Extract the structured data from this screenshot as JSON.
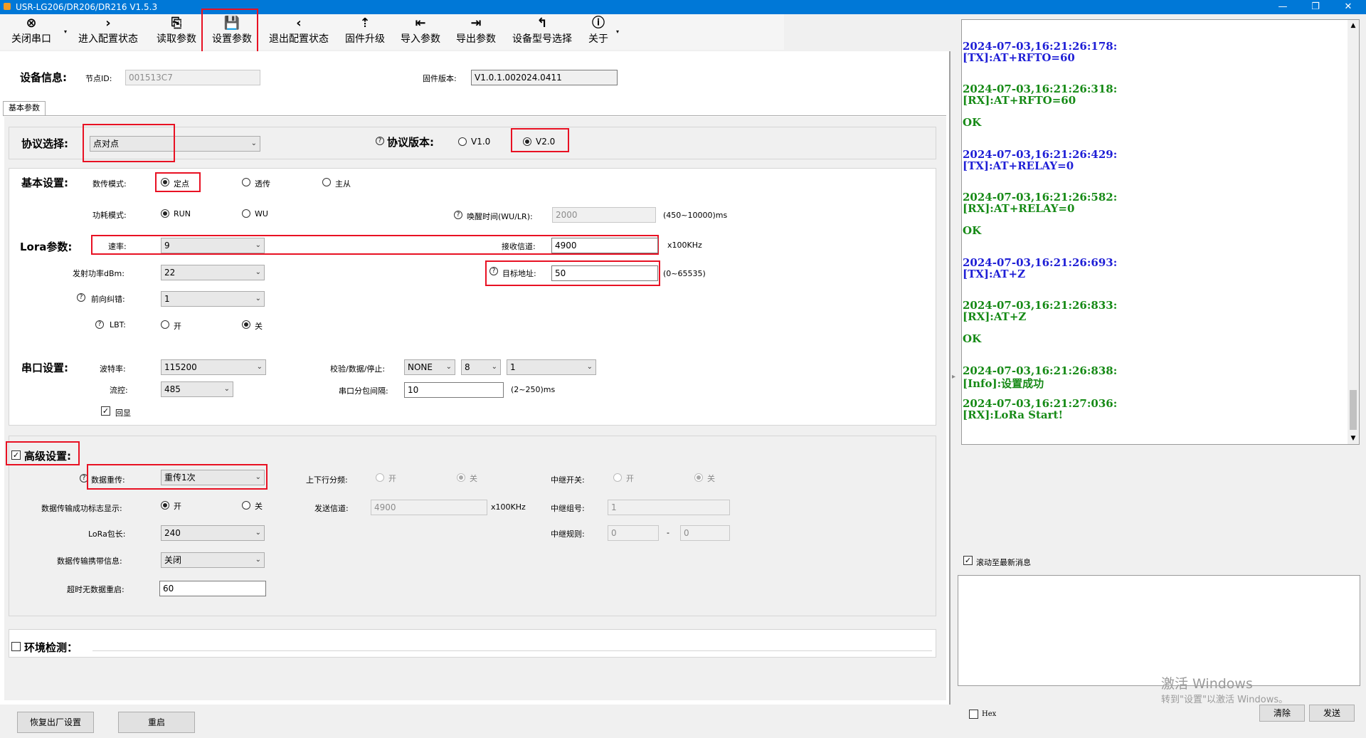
{
  "window": {
    "title": "USR-LG206/DR206/DR216 V1.5.3"
  },
  "toolbar": [
    {
      "label": "关闭串口",
      "icon": "⊗"
    },
    {
      "label": "进入配置状态",
      "icon": "›"
    },
    {
      "label": "读取参数",
      "icon": "⎘"
    },
    {
      "label": "设置参数",
      "icon": "💾"
    },
    {
      "label": "退出配置状态",
      "icon": "‹"
    },
    {
      "label": "固件升级",
      "icon": "⇡"
    },
    {
      "label": "导入参数",
      "icon": "⇤"
    },
    {
      "label": "导出参数",
      "icon": "⇥"
    },
    {
      "label": "设备型号选择",
      "icon": "↰"
    },
    {
      "label": "关于",
      "icon": "ⓘ"
    }
  ],
  "device": {
    "title": "设备信息:",
    "node_label": "节点ID:",
    "node_id": "001513C7",
    "fw_label": "固件版本:",
    "fw_version": "V1.0.1.002024.0411"
  },
  "tab": "基本参数",
  "protocol": {
    "label": "协议选择:",
    "value": "点对点",
    "ver_label": "协议版本:",
    "v1": "V1.0",
    "v2": "V2.0"
  },
  "basic": {
    "title": "基本设置:",
    "mode_label": "数传模式:",
    "mode_opts": [
      "定点",
      "透传",
      "主从"
    ],
    "power_label": "功耗模式:",
    "power_opts": [
      "RUN",
      "WU"
    ],
    "wake_label": "唤醒时间(WU/LR):",
    "wake_value": "2000",
    "wake_range": "(450~10000)ms"
  },
  "lora": {
    "title": "Lora参数:",
    "rate_label": "速率:",
    "rate": "9",
    "rx_ch_label": "接收信道:",
    "rx_ch": "4900",
    "rx_unit": "x100KHz",
    "txp_label": "发射功率dBm:",
    "txp": "22",
    "target_label": "目标地址:",
    "target": "50",
    "target_range": "(0~65535)",
    "fec_label": "前向纠错:",
    "fec": "1",
    "lbt_label": "LBT:",
    "on": "开",
    "off": "关"
  },
  "serial": {
    "title": "串口设置:",
    "baud_label": "波特率:",
    "baud": "115200",
    "parity_label": "校验/数据/停止:",
    "parity": "NONE",
    "data": "8",
    "stop": "1",
    "flow_label": "流控:",
    "flow": "485",
    "gap_label": "串口分包间隔:",
    "gap": "10",
    "gap_range": "(2~250)ms",
    "echo": "回显"
  },
  "advanced": {
    "title": "高级设置:",
    "retx_label": "数据重传:",
    "retx": "重传1次",
    "updown_label": "上下行分频:",
    "on": "开",
    "off": "关",
    "relay_label": "中继开关:",
    "succ_label": "数据传输成功标志显示:",
    "send_ch_label": "发送信道:",
    "send_ch": "4900",
    "send_unit": "x100KHz",
    "relay_grp_label": "中继组号:",
    "relay_grp": "1",
    "pkt_label": "LoRa包长:",
    "pkt": "240",
    "relay_rule_label": "中继规则:",
    "relay_rule_a": "0",
    "relay_rule_sep": "-",
    "relay_rule_b": "0",
    "carry_label": "数据传输携带信息:",
    "carry": "关闭",
    "timeout_label": "超时无数据重启:",
    "timeout": "60"
  },
  "env": {
    "title": "环境检测："
  },
  "footer": {
    "factory": "恢复出厂设置",
    "restart": "重启"
  },
  "log": [
    {
      "t": "2024-07-03,16:21:26:178:",
      "m": "[TX]:AT+RFTO=60",
      "c": "tx"
    },
    {
      "t": "2024-07-03,16:21:26:318:",
      "m": "[RX]:AT+RFTO=60",
      "c": "rx"
    },
    {
      "t": "OK",
      "m": "",
      "c": "rx"
    },
    {
      "t": "2024-07-03,16:21:26:429:",
      "m": "[TX]:AT+RELAY=0",
      "c": "tx"
    },
    {
      "t": "2024-07-03,16:21:26:582:",
      "m": "[RX]:AT+RELAY=0",
      "c": "rx"
    },
    {
      "t": "OK",
      "m": "",
      "c": "rx"
    },
    {
      "t": "2024-07-03,16:21:26:693:",
      "m": "[TX]:AT+Z",
      "c": "tx"
    },
    {
      "t": "2024-07-03,16:21:26:833:",
      "m": "[RX]:AT+Z",
      "c": "rx"
    },
    {
      "t": "OK",
      "m": "",
      "c": "rx"
    },
    {
      "t": "2024-07-03,16:21:26:838:",
      "m": "[Info]:设置成功",
      "c": "rx"
    },
    {
      "t": "2024-07-03,16:21:27:036:",
      "m": "[RX]:LoRa Start!",
      "c": "rx"
    }
  ],
  "right": {
    "autoscroll": "滚动至最新消息",
    "hex": "Hex",
    "clear": "清除",
    "send": "发送"
  },
  "watermark": {
    "line1": "激活 Windows",
    "line2": "转到\"设置\"以激活 Windows。"
  }
}
